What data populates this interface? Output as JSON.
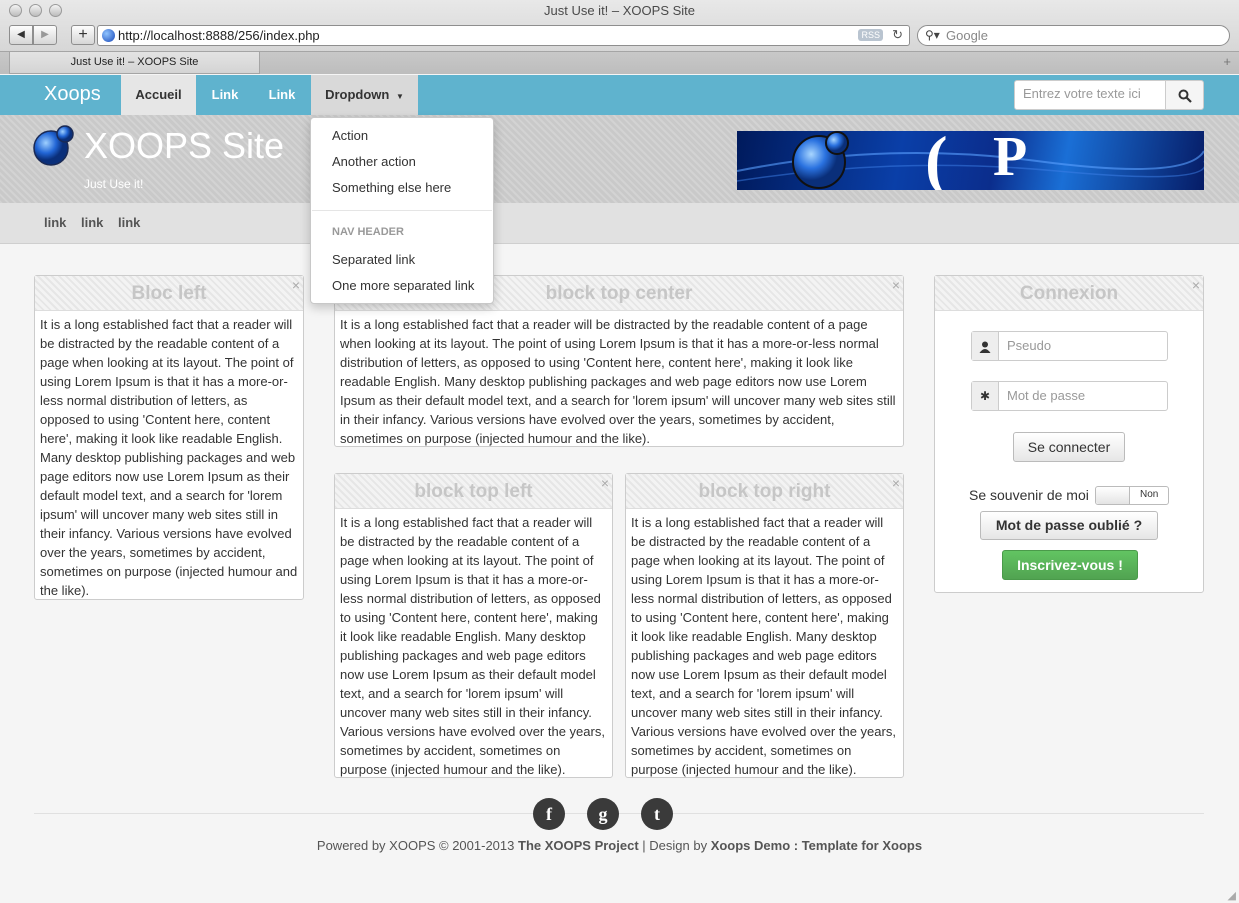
{
  "browser": {
    "window_title": "Just Use it! – XOOPS Site",
    "url": "http://localhost:8888/256/index.php",
    "rss_label": "RSS",
    "search_placeholder": "Google",
    "tab_title": "Just Use it! – XOOPS Site"
  },
  "navbar": {
    "brand": "Xoops",
    "items": [
      {
        "label": "Accueil"
      },
      {
        "label": "Link"
      },
      {
        "label": "Link"
      },
      {
        "label": "Dropdown"
      }
    ],
    "search_placeholder": "Entrez votre texte ici"
  },
  "dropdown": {
    "items": [
      "Action",
      "Another action",
      "Something else here"
    ],
    "header": "NAV HEADER",
    "separated": [
      "Separated link",
      "One more separated link"
    ]
  },
  "header": {
    "site_title": "XOOPS Site",
    "slogan": "Just Use it!"
  },
  "subnav": {
    "links": [
      "link",
      "link",
      "link"
    ]
  },
  "blocks": {
    "left": {
      "title": "Bloc left",
      "text": "It is a long established fact that a reader will be distracted by the readable content of a page when looking at its layout. The point of using Lorem Ipsum is that it has a more-or-less normal distribution of letters, as opposed to using 'Content here, content here', making it look like readable English. Many desktop publishing packages and web page editors now use Lorem Ipsum as their default model text, and a search for 'lorem ipsum' will uncover many web sites still in their infancy. Various versions have evolved over the years, sometimes by accident, sometimes on purpose (injected humour and the like)."
    },
    "top_center": {
      "title": "block top center",
      "text": "It is a long established fact that a reader will be distracted by the readable content of a page when looking at its layout. The point of using Lorem Ipsum is that it has a more-or-less normal distribution of letters, as opposed to using 'Content here, content here', making it look like readable English. Many desktop publishing packages and web page editors now use Lorem Ipsum as their default model text, and a search for 'lorem ipsum' will uncover many web sites still in their infancy. Various versions have evolved over the years, sometimes by accident, sometimes on purpose (injected humour and the like)."
    },
    "top_left": {
      "title": "block top left",
      "text": "It is a long established fact that a reader will be distracted by the readable content of a page when looking at its layout. The point of using Lorem Ipsum is that it has a more-or-less normal distribution of letters, as opposed to using 'Content here, content here', making it look like readable English. Many desktop publishing packages and web page editors now use Lorem Ipsum as their default model text, and a search for 'lorem ipsum' will uncover many web sites still in their infancy. Various versions have evolved over the years, sometimes by accident, sometimes on purpose (injected humour and the like)."
    },
    "top_right": {
      "title": "block top right",
      "text": "It is a long established fact that a reader will be distracted by the readable content of a page when looking at its layout. The point of using Lorem Ipsum is that it has a more-or-less normal distribution of letters, as opposed to using 'Content here, content here', making it look like readable English. Many desktop publishing packages and web page editors now use Lorem Ipsum as their default model text, and a search for 'lorem ipsum' will uncover many web sites still in their infancy. Various versions have evolved over the years, sometimes by accident, sometimes on purpose (injected humour and the like)."
    },
    "close_glyph": "×"
  },
  "login": {
    "title": "Connexion",
    "username_placeholder": "Pseudo",
    "password_placeholder": "Mot de passe",
    "submit": "Se connecter",
    "remember_label": "Se souvenir de moi",
    "remember_toggle": "Non",
    "lost_password": "Mot de passe oublié ?",
    "register": "Inscrivez-vous !"
  },
  "footer": {
    "social": [
      {
        "icon": "facebook-icon",
        "glyph": "f"
      },
      {
        "icon": "google-icon",
        "glyph": "g"
      },
      {
        "icon": "tumblr-icon",
        "glyph": "t"
      }
    ],
    "powered_prefix": "Powered by XOOPS © 2001-2013 ",
    "project": "The XOOPS Project",
    "design_prefix": " | Design by ",
    "design": "Xoops Demo : Template for Xoops"
  },
  "colors": {
    "navbar": "#5fb3ce",
    "register_button": "#5cb85c"
  }
}
